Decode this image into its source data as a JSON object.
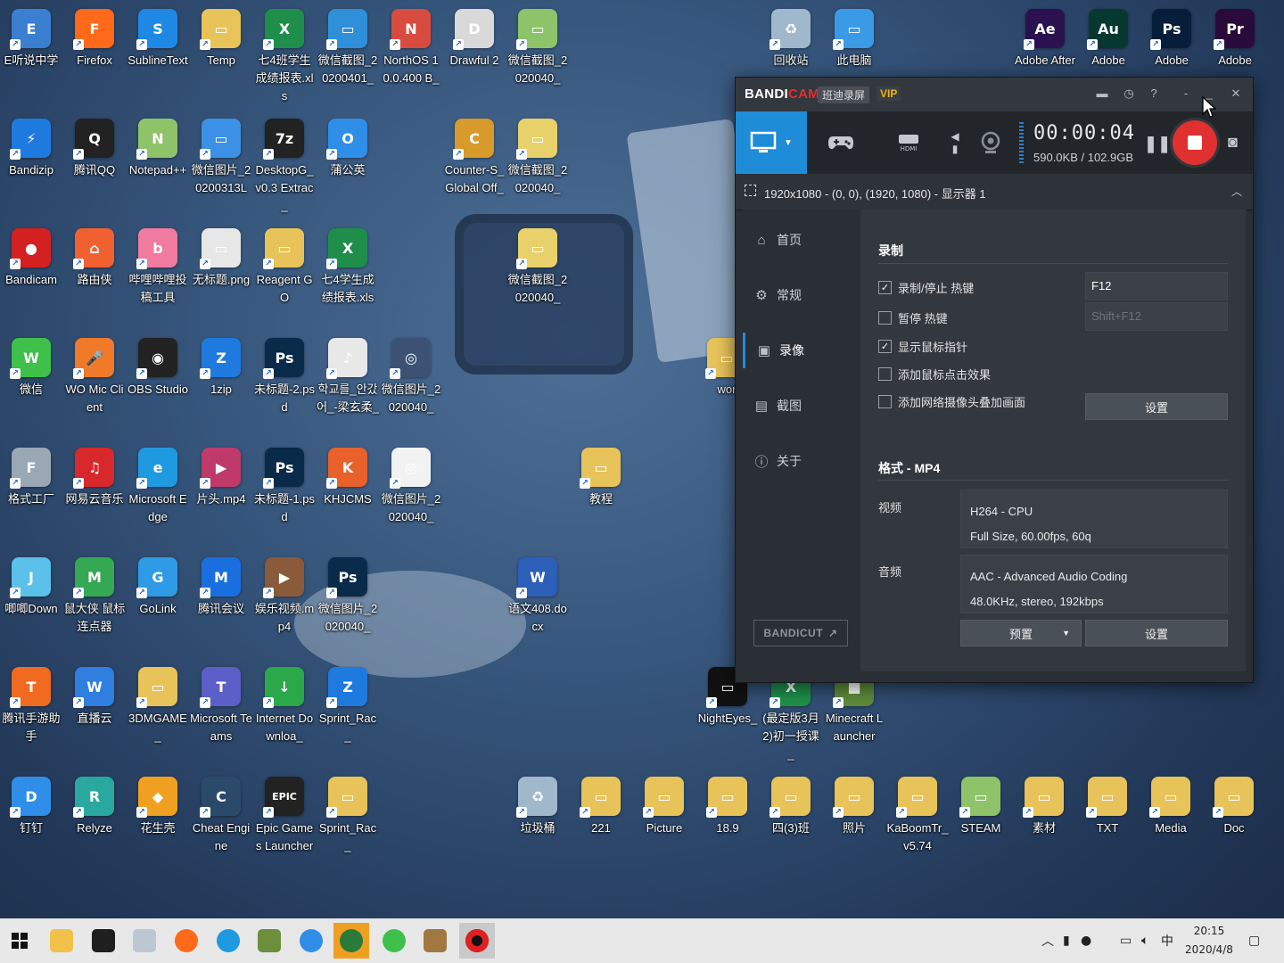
{
  "desktop": {
    "icons": [
      {
        "label": "E听说中学",
        "color": "#3a7fd0",
        "glyph": "E"
      },
      {
        "label": "Firefox",
        "color": "#ff6a1a",
        "glyph": "F"
      },
      {
        "label": "SublineText",
        "color": "#1f88e5",
        "glyph": "S"
      },
      {
        "label": "Temp",
        "color": "#e7c35a",
        "glyph": "▭"
      },
      {
        "label": "七4班学生成绩报表.xls",
        "color": "#1e8e4a",
        "glyph": "X"
      },
      {
        "label": "微信截图_20200401_",
        "color": "#2f8fd8",
        "glyph": "▭"
      },
      {
        "label": "NorthOS 10.0.400 B_",
        "color": "#d84c3f",
        "glyph": "N"
      },
      {
        "label": "Drawful 2",
        "color": "#d9d9d9",
        "glyph": "D"
      },
      {
        "label": "微信截图_2020040_",
        "color": "#8dc46a",
        "glyph": "▭"
      },
      {
        "label": "Bandizip",
        "color": "#1f7ae0",
        "glyph": "⚡"
      },
      {
        "label": "腾讯QQ",
        "color": "#222",
        "glyph": "Q"
      },
      {
        "label": "Notepad++",
        "color": "#8fc36a",
        "glyph": "N"
      },
      {
        "label": "微信图片_20200313L",
        "color": "#3c91e6",
        "glyph": "▭"
      },
      {
        "label": "DesktopG_ v0.3 Extrac_",
        "color": "#222",
        "glyph": "7z"
      },
      {
        "label": "蒲公英",
        "color": "#2f8ee8",
        "glyph": "O"
      },
      {
        "label": "Counter-S_ Global Off_",
        "color": "#d79a2b",
        "glyph": "C"
      },
      {
        "label": "微信截图_2020040_",
        "color": "#e8d06a",
        "glyph": "▭"
      },
      {
        "label": "Bandicam",
        "color": "#d32020",
        "glyph": "●"
      },
      {
        "label": "路由侠",
        "color": "#f06030",
        "glyph": "⌂"
      },
      {
        "label": "哔哩哔哩投稿工具",
        "color": "#f07aa0",
        "glyph": "b"
      },
      {
        "label": "无标题.png",
        "color": "#e7e7e7",
        "glyph": "▭"
      },
      {
        "label": "Reagent GO",
        "color": "#e7c35a",
        "glyph": "▭"
      },
      {
        "label": "七4学生成绩报表.xls",
        "color": "#1e8e4a",
        "glyph": "X"
      },
      {
        "label": "微信截图_2020040_",
        "color": "#e8d06a",
        "glyph": "▭"
      },
      {
        "label": "微信",
        "color": "#3ec04a",
        "glyph": "W"
      },
      {
        "label": "WO Mic Client",
        "color": "#f07a2a",
        "glyph": "🎤"
      },
      {
        "label": "OBS Studio",
        "color": "#222",
        "glyph": "◉"
      },
      {
        "label": "1zip",
        "color": "#1f7ae0",
        "glyph": "Z"
      },
      {
        "label": "未标题-2.psd",
        "color": "#0a2a4a",
        "glyph": "Ps"
      },
      {
        "label": "학교를_안갔어_-梁玄柔_",
        "color": "#e8e8e8",
        "glyph": "♪"
      },
      {
        "label": "微信图片_2020040_",
        "color": "#3b5275",
        "glyph": "◎"
      },
      {
        "label": "wor",
        "color": "#e7c35a",
        "glyph": "▭"
      },
      {
        "label": "格式工厂",
        "color": "#9aa7b5",
        "glyph": "F"
      },
      {
        "label": "网易云音乐",
        "color": "#d8282b",
        "glyph": "♫"
      },
      {
        "label": "Microsoft Edge",
        "color": "#1f9ae0",
        "glyph": "e"
      },
      {
        "label": "片头.mp4",
        "color": "#c0396b",
        "glyph": "▶"
      },
      {
        "label": "未标题-1.psd",
        "color": "#0a2a4a",
        "glyph": "Ps"
      },
      {
        "label": "KHJCMS",
        "color": "#e8602a",
        "glyph": "K"
      },
      {
        "label": "微信图片_2020040_",
        "color": "#f2f2f2",
        "glyph": "◎"
      },
      {
        "label": "教程",
        "color": "#e7c35a",
        "glyph": "▭"
      },
      {
        "label": "唧唧Down",
        "color": "#5bc0ea",
        "glyph": "J"
      },
      {
        "label": "鼠大侠 鼠标连点器",
        "color": "#34a853",
        "glyph": "M"
      },
      {
        "label": "GoLink",
        "color": "#2f9ae6",
        "glyph": "G"
      },
      {
        "label": "腾讯会议",
        "color": "#1a6fe0",
        "glyph": "M"
      },
      {
        "label": "娱乐视频.mp4",
        "color": "#8a5a3a",
        "glyph": "▶"
      },
      {
        "label": "微信图片_2020040_",
        "color": "#0a2a4a",
        "glyph": "Ps"
      },
      {
        "label": "语文408.docx",
        "color": "#2b5fb8",
        "glyph": "W"
      },
      {
        "label": "腾讯手游助手",
        "color": "#f06a20",
        "glyph": "T"
      },
      {
        "label": "直播云",
        "color": "#2f7fe0",
        "glyph": "W"
      },
      {
        "label": "3DMGAME_",
        "color": "#e7c35a",
        "glyph": "▭"
      },
      {
        "label": "Microsoft Teams",
        "color": "#5b5fc7",
        "glyph": "T"
      },
      {
        "label": "Internet Downloa_",
        "color": "#2aa84a",
        "glyph": "↓"
      },
      {
        "label": "Sprint_Rac_",
        "color": "#1f7ae0",
        "glyph": "Z"
      },
      {
        "label": "NightEyes_",
        "color": "#111",
        "glyph": "▭"
      },
      {
        "label": "(最定版3月2)初一授课_",
        "color": "#1e8e4a",
        "glyph": "X"
      },
      {
        "label": "Minecraft Launcher",
        "color": "#5d8a3a",
        "glyph": "■"
      },
      {
        "label": "钉钉",
        "color": "#2f8fe8",
        "glyph": "D"
      },
      {
        "label": "Relyze",
        "color": "#2aa8a0",
        "glyph": "R"
      },
      {
        "label": "花生壳",
        "color": "#f0a020",
        "glyph": "◆"
      },
      {
        "label": "Cheat Engine",
        "color": "#2a4a6a",
        "glyph": "C"
      },
      {
        "label": "Epic Games Launcher",
        "color": "#222",
        "glyph": "EPIC"
      },
      {
        "label": "Sprint_Rac_",
        "color": "#e7c35a",
        "glyph": "▭"
      },
      {
        "label": "垃圾桶",
        "color": "#9fb8cc",
        "glyph": "♻"
      },
      {
        "label": "221",
        "color": "#e7c35a",
        "glyph": "▭"
      },
      {
        "label": "Picture",
        "color": "#e7c35a",
        "glyph": "▭"
      },
      {
        "label": "18.9",
        "color": "#e7c35a",
        "glyph": "▭"
      },
      {
        "label": "四(3)班",
        "color": "#e7c35a",
        "glyph": "▭"
      },
      {
        "label": "照片",
        "color": "#e7c35a",
        "glyph": "▭"
      },
      {
        "label": "KaBoomTr_ v5.74",
        "color": "#e7c35a",
        "glyph": "▭"
      },
      {
        "label": "STEAM",
        "color": "#8fc36a",
        "glyph": "▭"
      },
      {
        "label": "素材",
        "color": "#e7c35a",
        "glyph": "▭"
      },
      {
        "label": "TXT",
        "color": "#e7c35a",
        "glyph": "▭"
      },
      {
        "label": "Media",
        "color": "#e7c35a",
        "glyph": "▭"
      },
      {
        "label": "Doc",
        "color": "#e7c35a",
        "glyph": "▭"
      },
      {
        "label": "回收站",
        "color": "#9fb8cc",
        "glyph": "♻"
      },
      {
        "label": "此电脑",
        "color": "#3a9ae6",
        "glyph": "▭"
      },
      {
        "label": "Adobe After",
        "color": "#2a1250",
        "glyph": "Ae"
      },
      {
        "label": "Adobe",
        "color": "#06382f",
        "glyph": "Au"
      },
      {
        "label": "Adobe",
        "color": "#061e3a",
        "glyph": "Ps"
      },
      {
        "label": "Adobe",
        "color": "#2a0a3a",
        "glyph": "Pr"
      }
    ]
  },
  "bandicam": {
    "logo_band": "BANDI",
    "logo_cam": "CAM",
    "subtitle": "班迪录屏",
    "vip": "VIP",
    "timer": "00:00:04",
    "size": "590.0KB / 102.9GB",
    "target": "1920x1080 - (0, 0), (1920, 1080) - 显示器 1",
    "colors": {
      "accent": "#1f8cd8",
      "record": "#e03030"
    },
    "sidebar": [
      {
        "label": "首页",
        "icon": "home-icon"
      },
      {
        "label": "常规",
        "icon": "gear-icon"
      },
      {
        "label": "录像",
        "icon": "video-icon"
      },
      {
        "label": "截图",
        "icon": "image-icon"
      },
      {
        "label": "关于",
        "icon": "info-icon"
      }
    ],
    "bandicut": "BANDICUT",
    "record_section": {
      "title": "录制",
      "options": [
        {
          "label": "录制/停止 热键",
          "checked": true
        },
        {
          "label": "暂停 热键",
          "checked": false
        },
        {
          "label": "显示鼠标指针",
          "checked": true
        },
        {
          "label": "添加鼠标点击效果",
          "checked": false
        },
        {
          "label": "添加网络摄像头叠加画面",
          "checked": false
        }
      ],
      "hotkey_record": "F12",
      "hotkey_pause": "Shift+F12",
      "settings_btn": "设置"
    },
    "format_section": {
      "title": "格式 - MP4",
      "video_label": "视频",
      "video_line1": "H264 - CPU",
      "video_line2": "Full Size, 60.00fps, 60q",
      "audio_label": "音频",
      "audio_line1": "AAC - Advanced Audio Coding",
      "audio_line2": "48.0KHz, stereo, 192kbps",
      "preset_btn": "预置",
      "settings_btn": "设置"
    }
  },
  "taskbar": {
    "ime": "中",
    "time": "20:15",
    "date": "2020/4/8"
  }
}
